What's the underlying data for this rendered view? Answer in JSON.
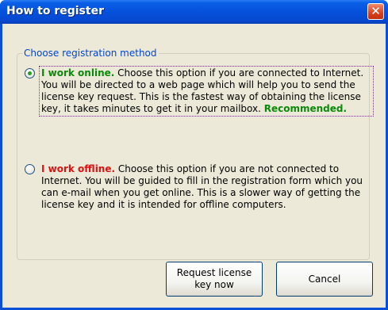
{
  "window": {
    "title": "How to register",
    "close_glyph": "✕"
  },
  "group": {
    "legend": "Choose registration method"
  },
  "options": [
    {
      "selected": true,
      "lead": "I work online.",
      "text": " Choose this option if you are connected to Internet. You will be directed to a web page which will help you to send the license key request. This is the fastest way of obtaining the license key, it takes minutes to get it in your mailbox. ",
      "recommended": "Recommended."
    },
    {
      "selected": false,
      "lead": "I work offline.",
      "text": " Choose this option if you are not connected to Internet. You will be guided to fill in the registration form which you can e-mail when you get online. This is a slower way of getting the license key and it is intended for offline computers."
    }
  ],
  "buttons": {
    "request_line1": "Request license",
    "request_line2": "key now",
    "cancel": "Cancel"
  },
  "colors": {
    "titlebar": "#0551dc",
    "accent_green": "#0a8a0a",
    "accent_red": "#e01010",
    "legend_blue": "#0046d5"
  }
}
